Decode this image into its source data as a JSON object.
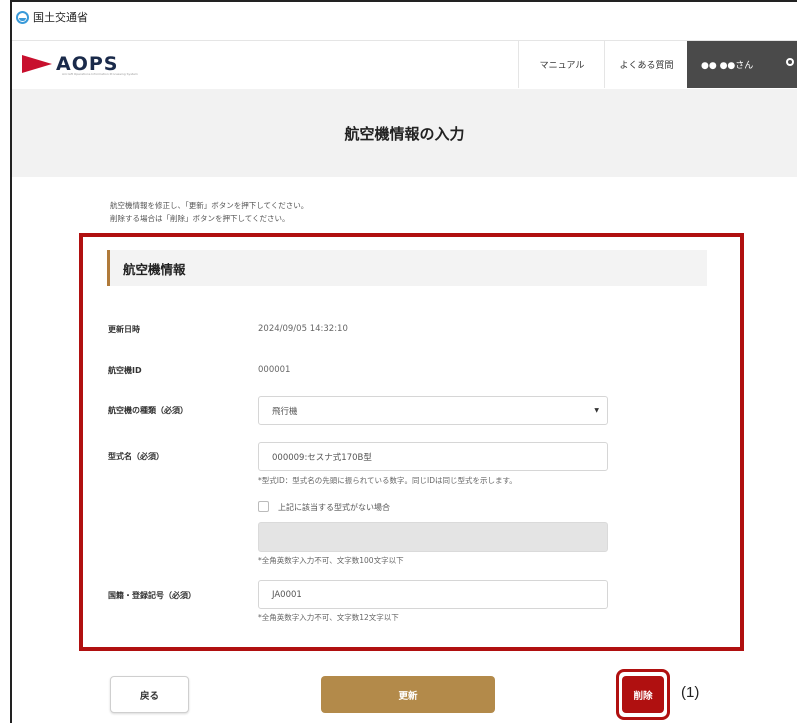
{
  "ministry": {
    "name": "国土交通省"
  },
  "header": {
    "logo_text": "AOPS",
    "logo_subtext": "Aircraft Operations Information Processing System",
    "nav": {
      "manual": "マニュアル",
      "faq": "よくある質問",
      "user": "●● ●●さん"
    }
  },
  "page": {
    "title": "航空機情報の入力",
    "instructions": [
      "航空機情報を修正し、「更新」ボタンを押下してください。",
      "削除する場合は「削除」ボタンを押下してください。"
    ]
  },
  "section": {
    "title": "航空機情報"
  },
  "form": {
    "updated_at": {
      "label": "更新日時",
      "value": "2024/09/05 14:32:10"
    },
    "aircraft_id": {
      "label": "航空機ID",
      "value": "000001"
    },
    "aircraft_type": {
      "label": "航空機の種類（必須）",
      "value": "飛行機"
    },
    "model": {
      "label": "型式名（必須）",
      "value": "000009:セスナ式170B型",
      "note": "*型式ID：型式名の先頭に振られている数字。同じIDは同じ型式を示します。",
      "checkbox_label": "上記に該当する型式がない場合",
      "free_note": "*全角英数字入力不可、文字数100文字以下"
    },
    "registration": {
      "label": "国籍・登録記号（必須）",
      "value": "JA0001",
      "note": "*全角英数字入力不可、文字数12文字以下"
    }
  },
  "buttons": {
    "back": "戻る",
    "update": "更新",
    "delete": "削除"
  },
  "callout": "(1)",
  "colors": {
    "accent": "#b01010",
    "update_button": "#b38a4a",
    "header_user_bg": "#4a4a4a"
  }
}
